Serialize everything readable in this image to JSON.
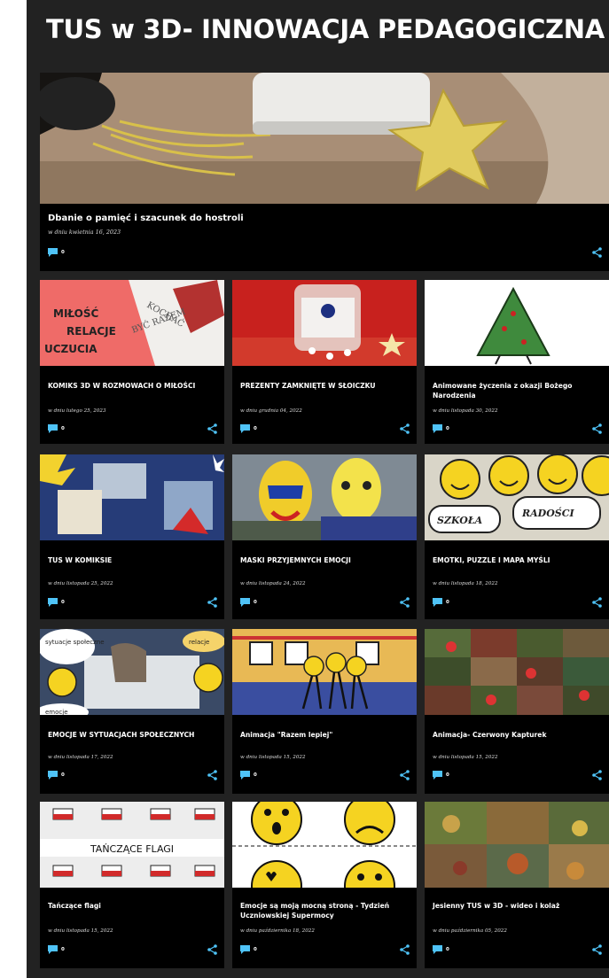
{
  "blog": {
    "title": "TUS w 3D- INNOWACJA PEDAGOGICZNA"
  },
  "ui": {
    "accent": "#4fc3f7",
    "icons": [
      "comment-icon",
      "share-icon"
    ]
  },
  "featured": {
    "title": "Dbanie o pamięć i szacunek do hostroli",
    "date": "w dniu kwietnia 16, 2023",
    "comments": "0",
    "image_text": []
  },
  "posts": [
    {
      "title": "KOMIKS 3D W ROZMOWACH O MIŁOŚCI",
      "date": "w dniu lutego 25, 2023",
      "comments": "0",
      "image_text": [
        "MIŁOŚĆ",
        "RELACJE",
        "UCZUCIA",
        "KOCHAĆ",
        "BYĆ RAZEM"
      ]
    },
    {
      "title": "PREZENTY ZAMKNIĘTE W SŁOICZKU",
      "date": "w dniu grudnia 04, 2022",
      "comments": "0",
      "image_text": []
    },
    {
      "title": "Animowane życzenia z okazji Bożego Narodzenia",
      "date": "w dniu listopada 30, 2022",
      "comments": "0",
      "image_text": []
    },
    {
      "title": "TUS W KOMIKSIE",
      "date": "w dniu listopada 25, 2022",
      "comments": "0",
      "image_text": []
    },
    {
      "title": "MASKI PRZYJEMNYCH EMOCJI",
      "date": "w dniu listopada 24, 2022",
      "comments": "0",
      "image_text": []
    },
    {
      "title": "EMOTKI, PUZZLE I MAPA MYŚLI",
      "date": "w dniu listopada 18, 2022",
      "comments": "0",
      "image_text": [
        "SZKOŁA",
        "RADOŚCI"
      ]
    },
    {
      "title": "EMOCJE W SYTUACJACH SPOŁECZNYCH",
      "date": "w dniu listopada 17, 2022",
      "comments": "0",
      "image_text": [
        "sytuacje społeczne",
        "relacje",
        "emocje"
      ]
    },
    {
      "title": "Animacja \"Razem lepiej\"",
      "date": "w dniu listopada 15, 2022",
      "comments": "0",
      "image_text": []
    },
    {
      "title": "Animacja- Czerwony Kapturek",
      "date": "w dniu listopada 15, 2022",
      "comments": "0",
      "image_text": []
    },
    {
      "title": "Tańczące flagi",
      "date": "w dniu listopada 15, 2022",
      "comments": "0",
      "image_text": [
        "TAŃCZĄCE FLAGI"
      ]
    },
    {
      "title": "Emocje są moją mocną stroną - Tydzień Uczniowskiej Supermocy",
      "date": "w dniu października 18, 2022",
      "comments": "0",
      "image_text": []
    },
    {
      "title": "Jesienny TUS w 3D - wideo i kolaż",
      "date": "w dniu października 05, 2022",
      "comments": "0",
      "image_text": []
    }
  ]
}
